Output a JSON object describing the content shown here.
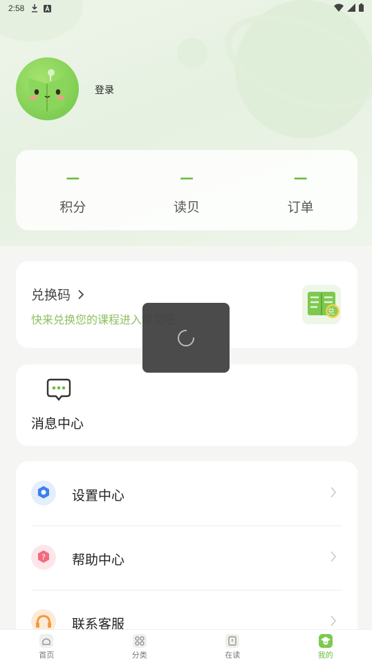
{
  "status_bar": {
    "time": "2:58",
    "left_icons": [
      "download-icon",
      "a-badge-icon"
    ],
    "right_icons": [
      "wifi-icon",
      "signal-icon",
      "battery-icon"
    ]
  },
  "profile": {
    "login_label": "登录"
  },
  "stats": [
    {
      "value": "—",
      "label": "积分"
    },
    {
      "value": "—",
      "label": "读贝"
    },
    {
      "value": "—",
      "label": "订单"
    }
  ],
  "redeem": {
    "title": "兑换码",
    "subtitle": "快来兑换您的课程进入学习吧",
    "badge": "兑"
  },
  "message_center": {
    "label": "消息中心"
  },
  "menu": [
    {
      "label": "设置中心",
      "icon": "settings-icon"
    },
    {
      "label": "帮助中心",
      "icon": "help-icon"
    },
    {
      "label": "联系客服",
      "icon": "customer-service-icon"
    }
  ],
  "tabs": [
    {
      "label": "首页",
      "icon": "home-icon"
    },
    {
      "label": "分类",
      "icon": "category-icon"
    },
    {
      "label": "在读",
      "icon": "reading-icon"
    },
    {
      "label": "我的",
      "icon": "profile-icon"
    }
  ],
  "colors": {
    "accent": "#6bbd3f",
    "subtitle_green": "#8cc060",
    "toast_bg": "#3c3c3c"
  }
}
